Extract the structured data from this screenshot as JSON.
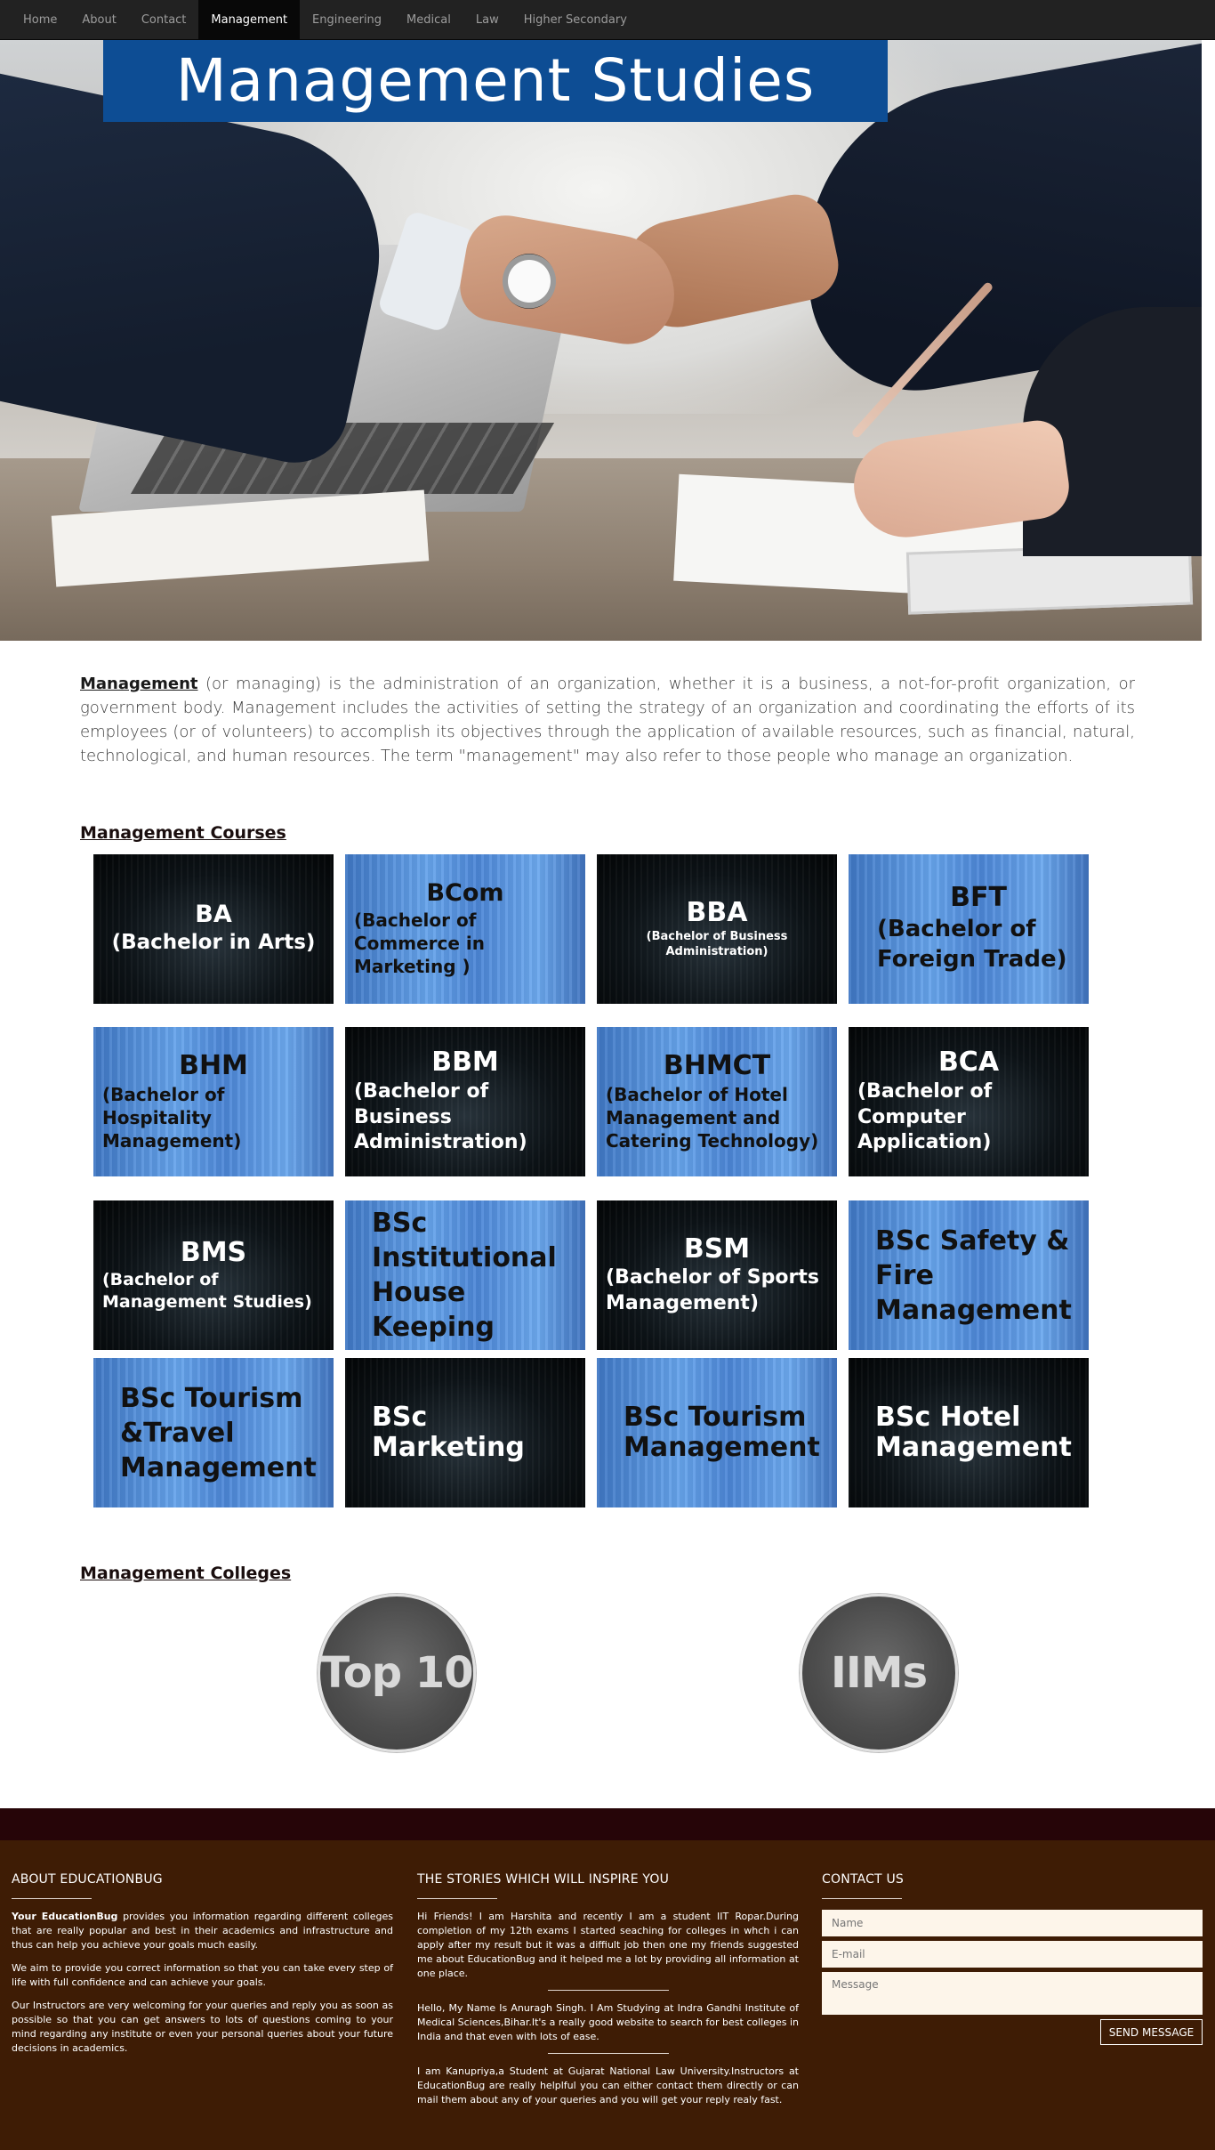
{
  "nav": {
    "items": [
      "Home",
      "About",
      "Contact",
      "Management",
      "Engineering",
      "Medical",
      "Law",
      "Higher Secondary"
    ],
    "active": "Management"
  },
  "hero": {
    "banner_title": "Management Studies"
  },
  "intro": {
    "term": "Management",
    "text": " (or managing) is the administration of an organization, whether it is a business, a not-for-profit organization, or government body. Management includes the activities of setting the strategy of an organization and coordinating the efforts of its employees (or of volunteers) to accomplish its objectives through the application of available resources, such as financial, natural, technological, and human resources. The term \"management\" may also refer to those people who manage an organization."
  },
  "courses": {
    "heading": "Management Courses",
    "items": [
      {
        "title": "BA",
        "subtitle": "(Bachelor in Arts)",
        "theme": "dark"
      },
      {
        "title": "BCom",
        "subtitle": "(Bachelor of Commerce in Marketing )",
        "theme": "blue"
      },
      {
        "title": "BBA",
        "subtitle": "(Bachelor of Business Administration)",
        "theme": "dark"
      },
      {
        "title": "BFT",
        "subtitle": "(Bachelor of Foreign Trade)",
        "theme": "blue"
      },
      {
        "title": "BHM",
        "subtitle": "(Bachelor of Hospitality Management)",
        "theme": "blue"
      },
      {
        "title": "BBM",
        "subtitle": "(Bachelor of Business Administration)",
        "theme": "dark"
      },
      {
        "title": "BHMCT",
        "subtitle": "(Bachelor of Hotel Management and Catering Technology)",
        "theme": "blue"
      },
      {
        "title": "BCA",
        "subtitle": "(Bachelor of Computer Application)",
        "theme": "dark"
      },
      {
        "title": "BMS",
        "subtitle": "(Bachelor of Management Studies)",
        "theme": "dark"
      },
      {
        "title": "BSc Institutional House Keeping",
        "subtitle": "",
        "theme": "blue"
      },
      {
        "title": "BSM",
        "subtitle": "(Bachelor of Sports Management)",
        "theme": "dark"
      },
      {
        "title": "BSc Safety & Fire Management",
        "subtitle": "",
        "theme": "blue"
      },
      {
        "title": "BSc Tourism &Travel Management",
        "subtitle": "",
        "theme": "blue"
      },
      {
        "title": "BSc Marketing",
        "subtitle": "",
        "theme": "dark"
      },
      {
        "title": "BSc Tourism Management",
        "subtitle": "",
        "theme": "blue"
      },
      {
        "title": "BSc Hotel Management",
        "subtitle": "",
        "theme": "dark"
      }
    ]
  },
  "colleges": {
    "heading": "Management Colleges",
    "items": [
      "Top 10",
      "IIMs"
    ]
  },
  "footer": {
    "about": {
      "heading": "ABOUT EDUCATIONBUG",
      "brand": "Your EducationBug",
      "p1_rest": " provides you information regarding different colleges that are really popular and best in their academics and infrastructure and thus can help you achieve your goals much easily.",
      "p2": "We aim to provide you correct information so that you can take every step of life with full confidence and can achieve your goals.",
      "p3": "Our Instructors are very welcoming for your queries and reply you as soon as possible so that you can get answers to lots of questions coming to your mind regarding any institute or even your personal queries about your future decisions in academics."
    },
    "stories": {
      "heading": "THE STORIES WHICH WILL INSPIRE YOU",
      "s1": "Hi Friends! I am Harshita and recently I am a student IIT Ropar.During completion of my 12th exams I started seaching for colleges in whch i can apply after my result but it was a diffiult job then one my friends suggested me about EducationBug and it helped me a lot by providing all information at one place.",
      "s2": "Hello, My Name Is Anuragh Singh. I Am Studying at Indra Gandhi Institute of Medical Sciences,Bihar.It's a really good website to search for best colleges in India and that even with lots of ease.",
      "s3": "I am Kanupriya,a Student at Gujarat National Law University.Instructors at EducationBug are really helplful you can either contact them directly or can mail them about any of your queries and you will get your reply realy fast."
    },
    "contact": {
      "heading": "CONTACT US",
      "name_placeholder": "Name",
      "email_placeholder": "E-mail",
      "message_placeholder": "Message",
      "send_label": "SEND MESSAGE"
    }
  }
}
